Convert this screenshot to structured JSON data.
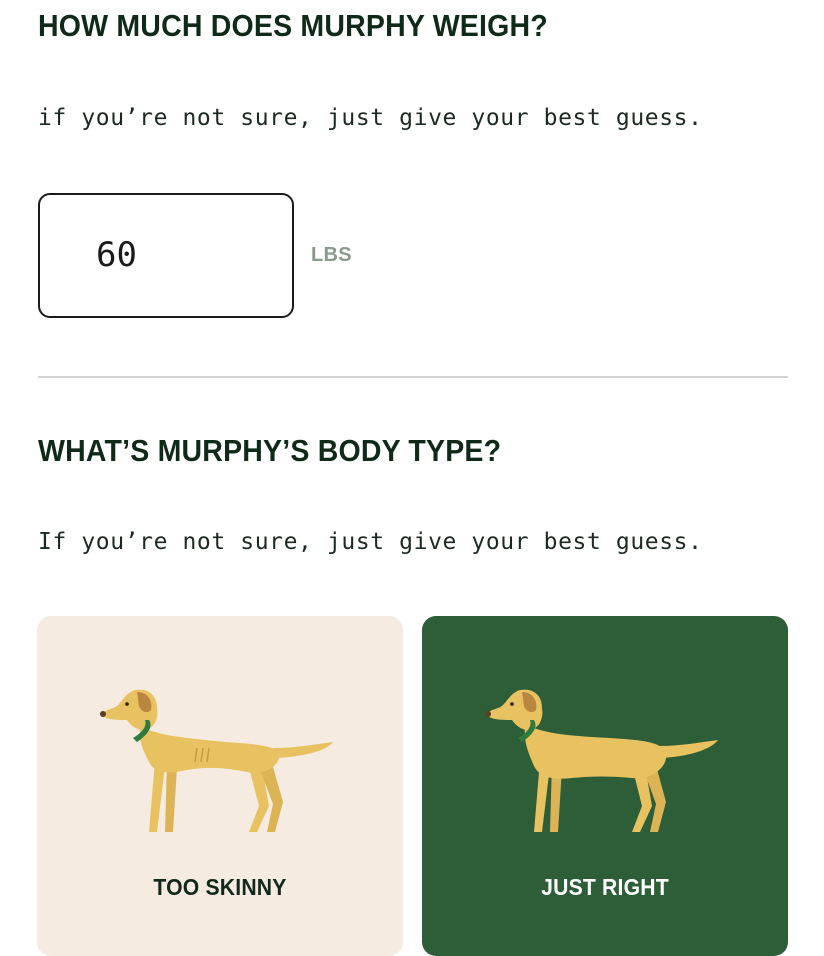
{
  "weight_section": {
    "title": "HOW MUCH DOES MURPHY WEIGH?",
    "helper": "if you’re not sure, just give your best guess.",
    "input_value": "60",
    "unit": "LBS"
  },
  "body_section": {
    "title": "WHAT’S MURPHY’S BODY TYPE?",
    "helper": "If you’re not sure, just give your best guess.",
    "options": [
      {
        "label": "TOO SKINNY",
        "selected": false,
        "icon": "dog-skinny-icon"
      },
      {
        "label": "JUST RIGHT",
        "selected": true,
        "icon": "dog-just-right-icon"
      }
    ]
  },
  "colors": {
    "title": "#0f2a18",
    "unit": "#8a9a8c",
    "card_unselected": "#f5ebe1",
    "card_selected": "#2d5e37",
    "dog_body": "#e8c260",
    "dog_ear": "#b9873f",
    "collar": "#2f7a3d"
  }
}
